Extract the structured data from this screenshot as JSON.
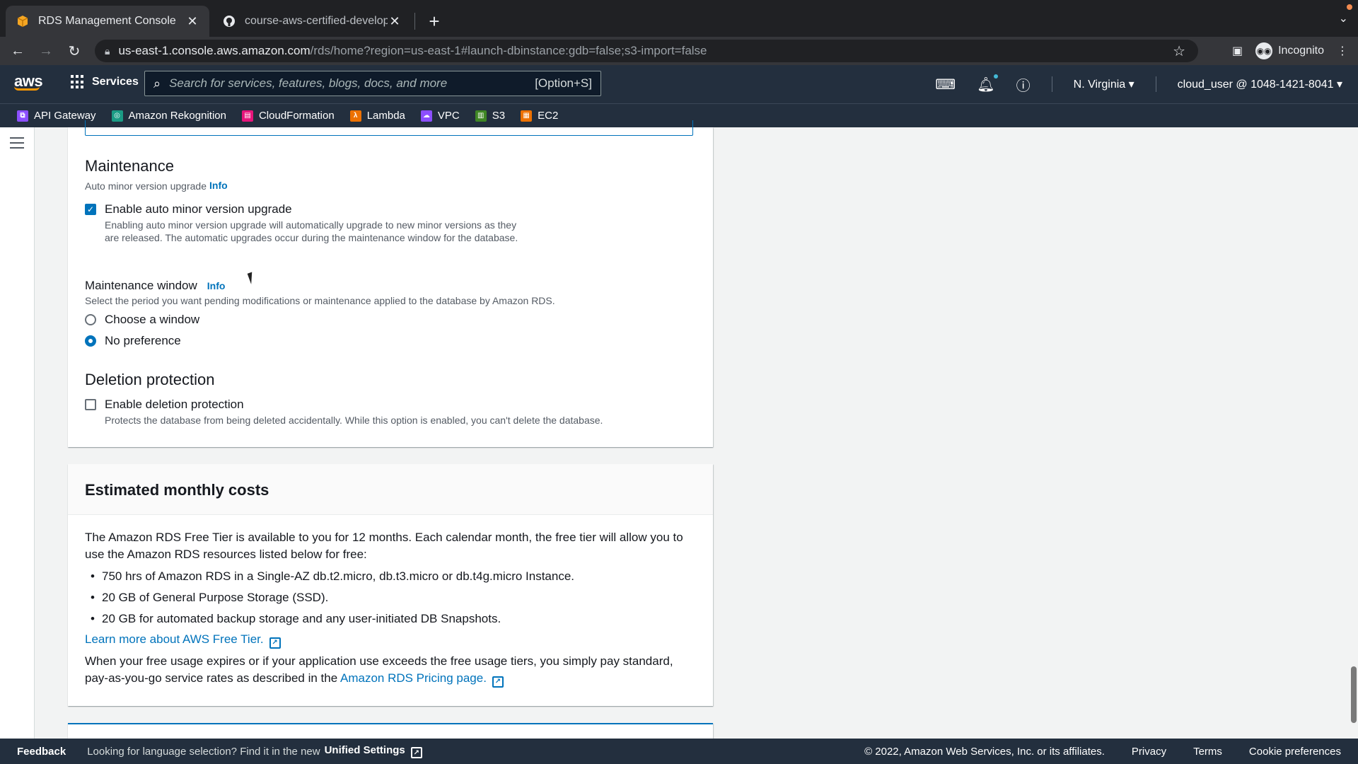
{
  "browser": {
    "tabs": [
      {
        "title": "RDS Management Console",
        "active": true
      },
      {
        "title": "course-aws-certified-develope",
        "active": false
      }
    ],
    "url_host": "us-east-1.console.aws.amazon.com",
    "url_path": "/rds/home?region=us-east-1#launch-dbinstance:gdb=false;s3-import=false",
    "profile_label": "Incognito"
  },
  "aws_header": {
    "logo": "aws",
    "services_label": "Services",
    "search_placeholder": "Search for services, features, blogs, docs, and more",
    "search_shortcut": "[Option+S]",
    "region": "N. Virginia",
    "account": "cloud_user @ 1048-1421-8041"
  },
  "favorites": [
    {
      "label": "API Gateway",
      "color": "#8c4fff"
    },
    {
      "label": "Amazon Rekognition",
      "color": "#1b9c85"
    },
    {
      "label": "CloudFormation",
      "color": "#e7157b"
    },
    {
      "label": "Lambda",
      "color": "#ed7100"
    },
    {
      "label": "VPC",
      "color": "#8c4fff"
    },
    {
      "label": "S3",
      "color": "#3f8624"
    },
    {
      "label": "EC2",
      "color": "#ed7100"
    }
  ],
  "maintenance": {
    "heading": "Maintenance",
    "auto_upgrade_label": "Auto minor version upgrade",
    "info": "Info",
    "enable_upgrade_label": "Enable auto minor version upgrade",
    "enable_upgrade_desc": "Enabling auto minor version upgrade will automatically upgrade to new minor versions as they are released. The automatic upgrades occur during the maintenance window for the database.",
    "window_label": "Maintenance window",
    "window_desc": "Select the period you want pending modifications or maintenance applied to the database by Amazon RDS.",
    "option_choose": "Choose a window",
    "option_none": "No preference"
  },
  "deletion": {
    "heading": "Deletion protection",
    "enable_label": "Enable deletion protection",
    "enable_desc": "Protects the database from being deleted accidentally. While this option is enabled, you can't delete the database."
  },
  "costs": {
    "heading": "Estimated monthly costs",
    "intro": "The Amazon RDS Free Tier is available to you for 12 months. Each calendar month, the free tier will allow you to use the Amazon RDS resources listed below for free:",
    "items": [
      "750 hrs of Amazon RDS in a Single-AZ db.t2.micro, db.t3.micro or db.t4g.micro Instance.",
      "20 GB of General Purpose Storage (SSD).",
      "20 GB for automated backup storage and any user-initiated DB Snapshots."
    ],
    "learn_more": "Learn more about AWS Free Tier.",
    "expire_text": "When your free usage expires or if your application use exceeds the free usage tiers, you simply pay standard, pay-as-you-go service rates as described in the",
    "pricing_link": "Amazon RDS Pricing page."
  },
  "footer": {
    "feedback": "Feedback",
    "lang_text": "Looking for language selection? Find it in the new",
    "unified": "Unified Settings",
    "copyright": "© 2022, Amazon Web Services, Inc. or its affiliates.",
    "privacy": "Privacy",
    "terms": "Terms",
    "cookies": "Cookie preferences"
  }
}
